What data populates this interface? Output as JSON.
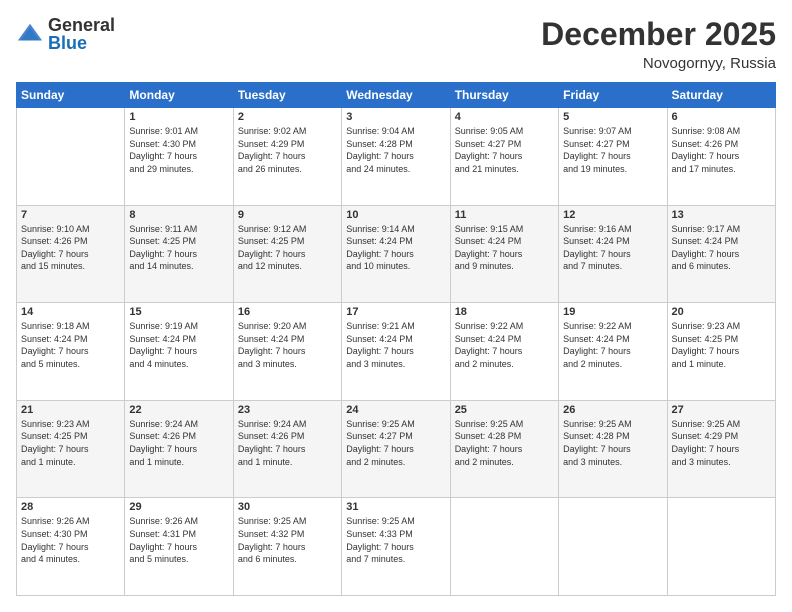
{
  "header": {
    "logo_general": "General",
    "logo_blue": "Blue",
    "month_year": "December 2025",
    "location": "Novogornyy, Russia"
  },
  "weekdays": [
    "Sunday",
    "Monday",
    "Tuesday",
    "Wednesday",
    "Thursday",
    "Friday",
    "Saturday"
  ],
  "weeks": [
    [
      {
        "day": "",
        "info": ""
      },
      {
        "day": "1",
        "info": "Sunrise: 9:01 AM\nSunset: 4:30 PM\nDaylight: 7 hours\nand 29 minutes."
      },
      {
        "day": "2",
        "info": "Sunrise: 9:02 AM\nSunset: 4:29 PM\nDaylight: 7 hours\nand 26 minutes."
      },
      {
        "day": "3",
        "info": "Sunrise: 9:04 AM\nSunset: 4:28 PM\nDaylight: 7 hours\nand 24 minutes."
      },
      {
        "day": "4",
        "info": "Sunrise: 9:05 AM\nSunset: 4:27 PM\nDaylight: 7 hours\nand 21 minutes."
      },
      {
        "day": "5",
        "info": "Sunrise: 9:07 AM\nSunset: 4:27 PM\nDaylight: 7 hours\nand 19 minutes."
      },
      {
        "day": "6",
        "info": "Sunrise: 9:08 AM\nSunset: 4:26 PM\nDaylight: 7 hours\nand 17 minutes."
      }
    ],
    [
      {
        "day": "7",
        "info": "Sunrise: 9:10 AM\nSunset: 4:26 PM\nDaylight: 7 hours\nand 15 minutes."
      },
      {
        "day": "8",
        "info": "Sunrise: 9:11 AM\nSunset: 4:25 PM\nDaylight: 7 hours\nand 14 minutes."
      },
      {
        "day": "9",
        "info": "Sunrise: 9:12 AM\nSunset: 4:25 PM\nDaylight: 7 hours\nand 12 minutes."
      },
      {
        "day": "10",
        "info": "Sunrise: 9:14 AM\nSunset: 4:24 PM\nDaylight: 7 hours\nand 10 minutes."
      },
      {
        "day": "11",
        "info": "Sunrise: 9:15 AM\nSunset: 4:24 PM\nDaylight: 7 hours\nand 9 minutes."
      },
      {
        "day": "12",
        "info": "Sunrise: 9:16 AM\nSunset: 4:24 PM\nDaylight: 7 hours\nand 7 minutes."
      },
      {
        "day": "13",
        "info": "Sunrise: 9:17 AM\nSunset: 4:24 PM\nDaylight: 7 hours\nand 6 minutes."
      }
    ],
    [
      {
        "day": "14",
        "info": "Sunrise: 9:18 AM\nSunset: 4:24 PM\nDaylight: 7 hours\nand 5 minutes."
      },
      {
        "day": "15",
        "info": "Sunrise: 9:19 AM\nSunset: 4:24 PM\nDaylight: 7 hours\nand 4 minutes."
      },
      {
        "day": "16",
        "info": "Sunrise: 9:20 AM\nSunset: 4:24 PM\nDaylight: 7 hours\nand 3 minutes."
      },
      {
        "day": "17",
        "info": "Sunrise: 9:21 AM\nSunset: 4:24 PM\nDaylight: 7 hours\nand 3 minutes."
      },
      {
        "day": "18",
        "info": "Sunrise: 9:22 AM\nSunset: 4:24 PM\nDaylight: 7 hours\nand 2 minutes."
      },
      {
        "day": "19",
        "info": "Sunrise: 9:22 AM\nSunset: 4:24 PM\nDaylight: 7 hours\nand 2 minutes."
      },
      {
        "day": "20",
        "info": "Sunrise: 9:23 AM\nSunset: 4:25 PM\nDaylight: 7 hours\nand 1 minute."
      }
    ],
    [
      {
        "day": "21",
        "info": "Sunrise: 9:23 AM\nSunset: 4:25 PM\nDaylight: 7 hours\nand 1 minute."
      },
      {
        "day": "22",
        "info": "Sunrise: 9:24 AM\nSunset: 4:26 PM\nDaylight: 7 hours\nand 1 minute."
      },
      {
        "day": "23",
        "info": "Sunrise: 9:24 AM\nSunset: 4:26 PM\nDaylight: 7 hours\nand 1 minute."
      },
      {
        "day": "24",
        "info": "Sunrise: 9:25 AM\nSunset: 4:27 PM\nDaylight: 7 hours\nand 2 minutes."
      },
      {
        "day": "25",
        "info": "Sunrise: 9:25 AM\nSunset: 4:28 PM\nDaylight: 7 hours\nand 2 minutes."
      },
      {
        "day": "26",
        "info": "Sunrise: 9:25 AM\nSunset: 4:28 PM\nDaylight: 7 hours\nand 3 minutes."
      },
      {
        "day": "27",
        "info": "Sunrise: 9:25 AM\nSunset: 4:29 PM\nDaylight: 7 hours\nand 3 minutes."
      }
    ],
    [
      {
        "day": "28",
        "info": "Sunrise: 9:26 AM\nSunset: 4:30 PM\nDaylight: 7 hours\nand 4 minutes."
      },
      {
        "day": "29",
        "info": "Sunrise: 9:26 AM\nSunset: 4:31 PM\nDaylight: 7 hours\nand 5 minutes."
      },
      {
        "day": "30",
        "info": "Sunrise: 9:25 AM\nSunset: 4:32 PM\nDaylight: 7 hours\nand 6 minutes."
      },
      {
        "day": "31",
        "info": "Sunrise: 9:25 AM\nSunset: 4:33 PM\nDaylight: 7 hours\nand 7 minutes."
      },
      {
        "day": "",
        "info": ""
      },
      {
        "day": "",
        "info": ""
      },
      {
        "day": "",
        "info": ""
      }
    ]
  ]
}
